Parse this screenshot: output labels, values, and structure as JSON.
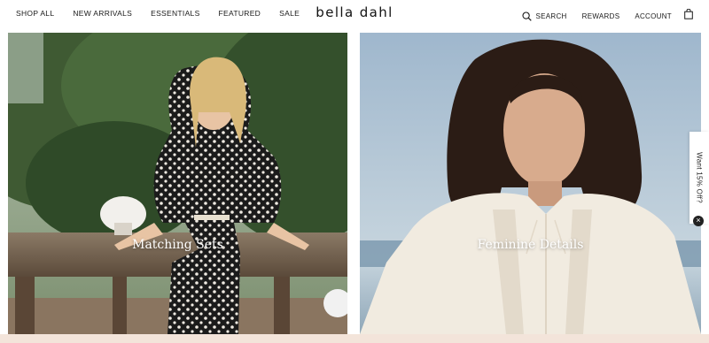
{
  "header": {
    "nav_left": [
      "SHOP ALL",
      "NEW ARRIVALS",
      "ESSENTIALS",
      "FEATURED",
      "SALE"
    ],
    "logo": "bella dahl",
    "search_label": "SEARCH",
    "rewards_label": "REWARDS",
    "account_label": "ACCOUNT",
    "icons": {
      "search": "search-icon",
      "bag": "shopping-bag-icon"
    }
  },
  "hero": {
    "left": {
      "title": "Matching Sets"
    },
    "right": {
      "title": "Feminine Details"
    }
  },
  "promo": {
    "tab_text": "Want 15% Off?",
    "close_icon": "close-icon"
  },
  "colors": {
    "text": "#1a1a1a",
    "background": "#ffffff",
    "bottom_strip": "#f3e4da"
  }
}
